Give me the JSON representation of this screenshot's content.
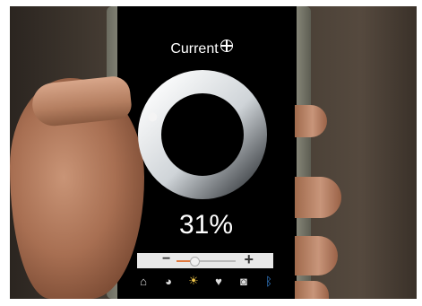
{
  "screen": {
    "title": "Current",
    "level_percent": 31,
    "level_text": "31%",
    "accent_color": "#f2c84b",
    "bluetooth_color": "#3a8ee6"
  },
  "slider": {
    "minus_label": "−",
    "plus_label": "+",
    "value_fraction": 0.31
  },
  "tabs": [
    {
      "icon": "home-icon",
      "glyph": "⌂"
    },
    {
      "icon": "globe-icon",
      "glyph": "◕"
    },
    {
      "icon": "sun-icon",
      "glyph": "☀",
      "active": true
    },
    {
      "icon": "heart-icon",
      "glyph": "♥"
    },
    {
      "icon": "camera-icon",
      "glyph": "◙"
    },
    {
      "icon": "bluetooth-icon",
      "glyph": "ᛒ"
    }
  ]
}
